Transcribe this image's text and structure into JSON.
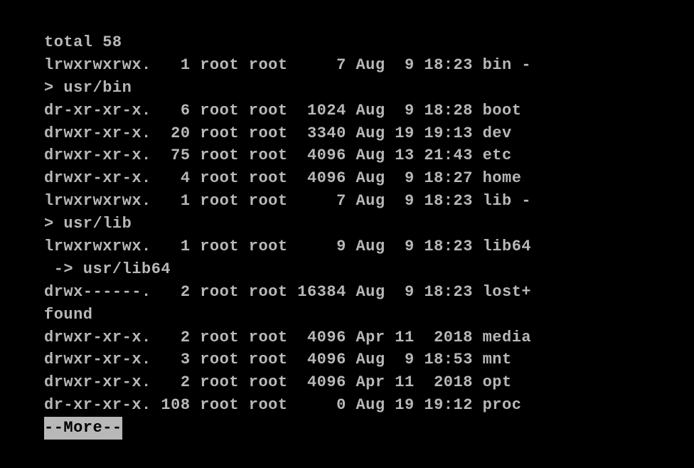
{
  "terminal": {
    "lines": [
      "total 58",
      "lrwxrwxrwx.   1 root root     7 Aug  9 18:23 bin -",
      "> usr/bin",
      "dr-xr-xr-x.   6 root root  1024 Aug  9 18:28 boot",
      "drwxr-xr-x.  20 root root  3340 Aug 19 19:13 dev",
      "drwxr-xr-x.  75 root root  4096 Aug 13 21:43 etc",
      "drwxr-xr-x.   4 root root  4096 Aug  9 18:27 home",
      "lrwxrwxrwx.   1 root root     7 Aug  9 18:23 lib -",
      "> usr/lib",
      "lrwxrwxrwx.   1 root root     9 Aug  9 18:23 lib64",
      " -> usr/lib64",
      "drwx------.   2 root root 16384 Aug  9 18:23 lost+",
      "found",
      "drwxr-xr-x.   2 root root  4096 Apr 11  2018 media",
      "drwxr-xr-x.   3 root root  4096 Aug  9 18:53 mnt",
      "drwxr-xr-x.   2 root root  4096 Apr 11  2018 opt",
      "dr-xr-xr-x. 108 root root     0 Aug 19 19:12 proc"
    ],
    "more_prompt": "--More--"
  },
  "listing": {
    "total": 58,
    "entries": [
      {
        "perms": "lrwxrwxrwx.",
        "links": 1,
        "owner": "root",
        "group": "root",
        "size": 7,
        "month": "Aug",
        "day": 9,
        "time": "18:23",
        "name": "bin",
        "target": "usr/bin"
      },
      {
        "perms": "dr-xr-xr-x.",
        "links": 6,
        "owner": "root",
        "group": "root",
        "size": 1024,
        "month": "Aug",
        "day": 9,
        "time": "18:28",
        "name": "boot"
      },
      {
        "perms": "drwxr-xr-x.",
        "links": 20,
        "owner": "root",
        "group": "root",
        "size": 3340,
        "month": "Aug",
        "day": 19,
        "time": "19:13",
        "name": "dev"
      },
      {
        "perms": "drwxr-xr-x.",
        "links": 75,
        "owner": "root",
        "group": "root",
        "size": 4096,
        "month": "Aug",
        "day": 13,
        "time": "21:43",
        "name": "etc"
      },
      {
        "perms": "drwxr-xr-x.",
        "links": 4,
        "owner": "root",
        "group": "root",
        "size": 4096,
        "month": "Aug",
        "day": 9,
        "time": "18:27",
        "name": "home"
      },
      {
        "perms": "lrwxrwxrwx.",
        "links": 1,
        "owner": "root",
        "group": "root",
        "size": 7,
        "month": "Aug",
        "day": 9,
        "time": "18:23",
        "name": "lib",
        "target": "usr/lib"
      },
      {
        "perms": "lrwxrwxrwx.",
        "links": 1,
        "owner": "root",
        "group": "root",
        "size": 9,
        "month": "Aug",
        "day": 9,
        "time": "18:23",
        "name": "lib64",
        "target": "usr/lib64"
      },
      {
        "perms": "drwx------.",
        "links": 2,
        "owner": "root",
        "group": "root",
        "size": 16384,
        "month": "Aug",
        "day": 9,
        "time": "18:23",
        "name": "lost+found"
      },
      {
        "perms": "drwxr-xr-x.",
        "links": 2,
        "owner": "root",
        "group": "root",
        "size": 4096,
        "month": "Apr",
        "day": 11,
        "time": "2018",
        "name": "media"
      },
      {
        "perms": "drwxr-xr-x.",
        "links": 3,
        "owner": "root",
        "group": "root",
        "size": 4096,
        "month": "Aug",
        "day": 9,
        "time": "18:53",
        "name": "mnt"
      },
      {
        "perms": "drwxr-xr-x.",
        "links": 2,
        "owner": "root",
        "group": "root",
        "size": 4096,
        "month": "Apr",
        "day": 11,
        "time": "2018",
        "name": "opt"
      },
      {
        "perms": "dr-xr-xr-x.",
        "links": 108,
        "owner": "root",
        "group": "root",
        "size": 0,
        "month": "Aug",
        "day": 19,
        "time": "19:12",
        "name": "proc"
      }
    ]
  }
}
